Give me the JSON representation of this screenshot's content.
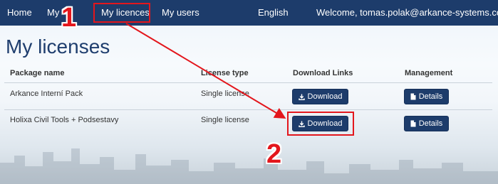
{
  "nav": {
    "home": "Home",
    "my": "My",
    "my_licences": "My licences",
    "my_users": "My users",
    "language": "English",
    "welcome": "Welcome, tomas.polak@arkance-systems.com"
  },
  "page": {
    "title": "My licenses"
  },
  "table": {
    "headers": {
      "package": "Package name",
      "license_type": "License type",
      "download_links": "Download Links",
      "management": "Management"
    },
    "rows": [
      {
        "package": "Arkance Interní Pack",
        "license_type": "Single license",
        "download": "Download",
        "details": "Details"
      },
      {
        "package": "Holixa Civil Tools + Podsestavy",
        "license_type": "Single license",
        "download": "Download",
        "details": "Details"
      }
    ]
  },
  "annotations": {
    "step1": "1",
    "step2": "2",
    "color": "#e3161c"
  },
  "colors": {
    "navbar": "#1d3c6b",
    "button": "#1d3c6b",
    "title": "#1f3e6e"
  },
  "icons": {
    "download": "download-icon",
    "details": "document-icon",
    "language_caret": "caret-down-icon"
  }
}
